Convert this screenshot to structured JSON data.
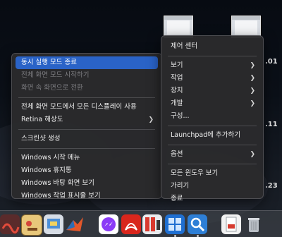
{
  "desktop_labels": {
    "right_1": ".01",
    "right_2": ".11",
    "right_3": ".23"
  },
  "app_menu": {
    "items": [
      {
        "label": "동시 실행 모드 종료",
        "state": "highlight"
      },
      {
        "label": "전체 화면 모드 시작하기",
        "state": "disabled"
      },
      {
        "label": "화면 속 화면으로 전환",
        "state": "disabled"
      },
      {
        "label": "전체 화면 모드에서 모든 디스플레이 사용",
        "state": "normal"
      },
      {
        "label": "Retina 해상도",
        "state": "submenu"
      },
      {
        "label": "스크린샷 생성",
        "state": "normal"
      },
      {
        "label": "Windows 시작 메뉴",
        "state": "normal"
      },
      {
        "label": "Windows 휴지통",
        "state": "normal"
      },
      {
        "label": "Windows 바탕 화면 보기",
        "state": "normal"
      },
      {
        "label": "Windows 작업 표시줄 보기",
        "state": "normal"
      }
    ]
  },
  "dock_menu": {
    "items": [
      {
        "label": "제어 센터"
      },
      {
        "label": "보기"
      },
      {
        "label": "작업"
      },
      {
        "label": "장치"
      },
      {
        "label": "개발"
      },
      {
        "label": "구성..."
      },
      {
        "label": "Launchpad에 추가하기"
      },
      {
        "label": "옵션"
      },
      {
        "label": "모든 윈도우 보기"
      },
      {
        "label": "가리기"
      },
      {
        "label": "종료"
      }
    ]
  },
  "colors": {
    "highlight": "#2a63c7",
    "menu_bg": "#2a2a2c"
  },
  "dock": {
    "icons": [
      "system-icon",
      "toolbox-icon",
      "preview-icon",
      "matlab-icon",
      "messenger-icon",
      "acrobat-icon",
      "parallels-icon",
      "windows-icon",
      "search-app-icon",
      "document-icon",
      "trash-icon"
    ]
  }
}
